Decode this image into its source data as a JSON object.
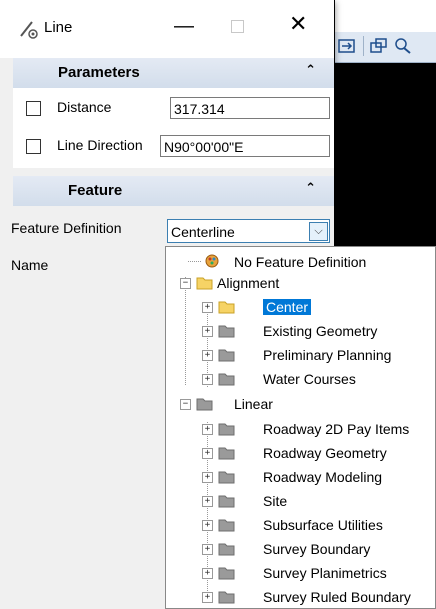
{
  "window": {
    "title": "Line",
    "minimize": "—",
    "close": "✕"
  },
  "sections": {
    "parameters": {
      "title": "Parameters",
      "collapse_glyph": "⌃",
      "distance_label": "Distance",
      "distance_value": "317.314",
      "direction_label": "Line Direction",
      "direction_value": "N90°00'00\"E"
    },
    "feature": {
      "title": "Feature",
      "collapse_glyph": "⌃",
      "definition_label": "Feature Definition",
      "definition_value": "Centerline",
      "name_label": "Name"
    }
  },
  "dropdown": {
    "arrow": "⌵",
    "items": [
      {
        "label": "No Feature Definition",
        "icon": "feature-definition-icon"
      },
      {
        "label": "Alignment",
        "icon": "open-folder-icon"
      },
      {
        "label": "Center",
        "icon": "open-folder-icon",
        "selected": true
      },
      {
        "label": "Existing Geometry",
        "icon": "folder-icon"
      },
      {
        "label": "Preliminary Planning",
        "icon": "folder-icon"
      },
      {
        "label": "Water Courses",
        "icon": "folder-icon"
      },
      {
        "label": "Linear",
        "icon": "folder-icon"
      },
      {
        "label": "Roadway 2D Pay Items",
        "icon": "folder-icon"
      },
      {
        "label": "Roadway Geometry",
        "icon": "folder-icon"
      },
      {
        "label": "Roadway Modeling",
        "icon": "folder-icon"
      },
      {
        "label": "Site",
        "icon": "folder-icon"
      },
      {
        "label": "Subsurface Utilities",
        "icon": "folder-icon"
      },
      {
        "label": "Survey Boundary",
        "icon": "folder-icon"
      },
      {
        "label": "Survey Planimetrics",
        "icon": "folder-icon"
      },
      {
        "label": "Survey Ruled Boundary",
        "icon": "folder-icon"
      }
    ],
    "expander_plus": "+",
    "expander_minus": "−"
  },
  "colors": {
    "selection": "#0078d7",
    "section_header": "#d9e3ef",
    "folder_gray": "#9a9a9a",
    "folder_yellow": "#f6d365"
  }
}
